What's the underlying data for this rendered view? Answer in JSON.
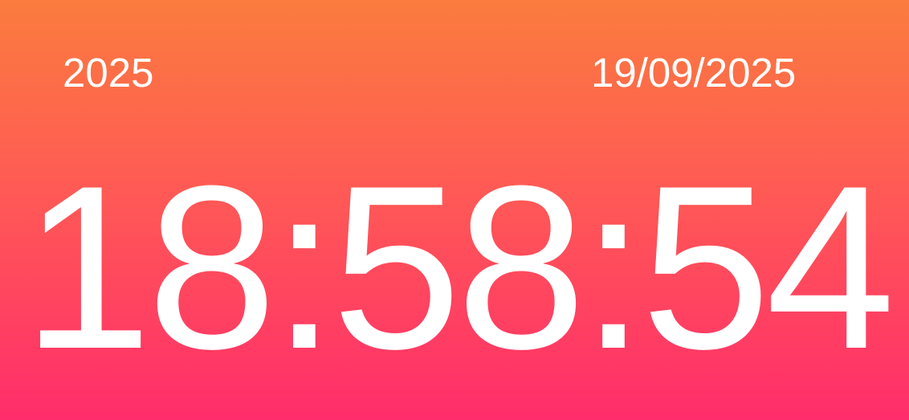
{
  "clock": {
    "year": "2025",
    "date": "19/09/2025",
    "time": "18:58:54"
  },
  "colors": {
    "gradient_top": "#FB7C3E",
    "gradient_mid": "#FF5A55",
    "gradient_bottom": "#FF2D6B",
    "text": "#FFFFFF"
  }
}
